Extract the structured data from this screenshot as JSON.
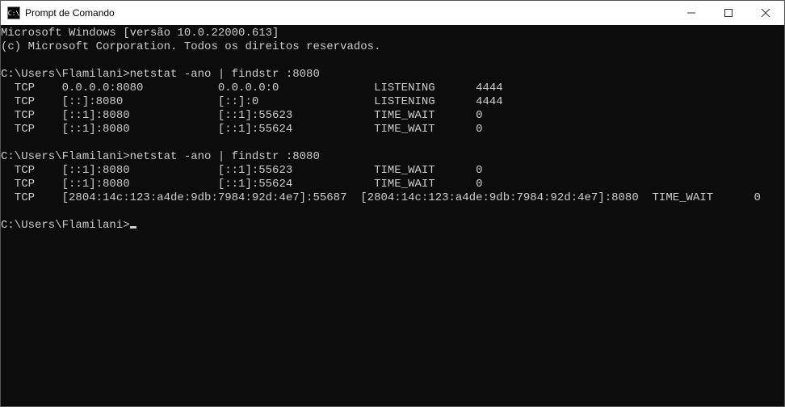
{
  "window": {
    "title": "Prompt de Comando",
    "icon_text": "C:\\"
  },
  "terminal": {
    "header": {
      "line1": "Microsoft Windows [versão 10.0.22000.613]",
      "line2": "(c) Microsoft Corporation. Todos os direitos reservados."
    },
    "prompt_path": "C:\\Users\\Flamilani>",
    "blocks": [
      {
        "command": "netstat -ano | findstr :8080",
        "rows": [
          {
            "proto": "TCP",
            "local": "0.0.0.0:8080",
            "foreign": "0.0.0.0:0",
            "state": "LISTENING",
            "pid": "4444"
          },
          {
            "proto": "TCP",
            "local": "[::]:8080",
            "foreign": "[::]:0",
            "state": "LISTENING",
            "pid": "4444"
          },
          {
            "proto": "TCP",
            "local": "[::1]:8080",
            "foreign": "[::1]:55623",
            "state": "TIME_WAIT",
            "pid": "0"
          },
          {
            "proto": "TCP",
            "local": "[::1]:8080",
            "foreign": "[::1]:55624",
            "state": "TIME_WAIT",
            "pid": "0"
          }
        ]
      },
      {
        "command": "netstat -ano | findstr :8080",
        "rows": [
          {
            "proto": "TCP",
            "local": "[::1]:8080",
            "foreign": "[::1]:55623",
            "state": "TIME_WAIT",
            "pid": "0"
          },
          {
            "proto": "TCP",
            "local": "[::1]:8080",
            "foreign": "[::1]:55624",
            "state": "TIME_WAIT",
            "pid": "0"
          },
          {
            "proto": "TCP",
            "local": "[2804:14c:123:a4de:9db:7984:92d:4e7]:55687",
            "foreign": "[2804:14c:123:a4de:9db:7984:92d:4e7]:8080",
            "state": "TIME_WAIT",
            "pid": "0",
            "long": true
          }
        ]
      }
    ]
  }
}
